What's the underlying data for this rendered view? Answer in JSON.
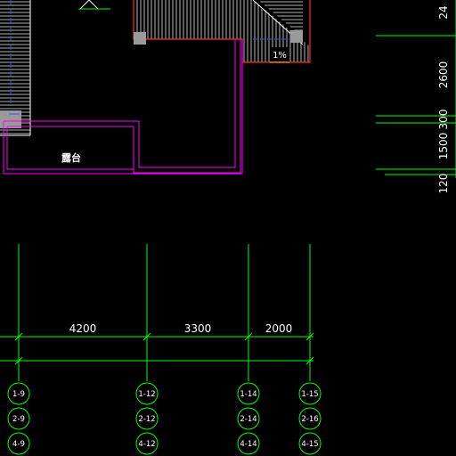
{
  "drawing": {
    "room_label": "露台",
    "slope_label": "1%",
    "horizontal_dimensions": [
      "4200",
      "3300",
      "2000"
    ],
    "vertical_dimensions": [
      "24",
      "2600",
      "300",
      "1500",
      "120"
    ],
    "axis_columns": [
      {
        "bubbles": [
          "1-9",
          "2-9",
          "4-9"
        ]
      },
      {
        "bubbles": [
          "1-12",
          "2-12",
          "4-12"
        ]
      },
      {
        "bubbles": [
          "1-14",
          "2-14",
          "4-14"
        ]
      },
      {
        "bubbles": [
          "1-15",
          "2-16",
          "4-15"
        ]
      }
    ]
  },
  "colors": {
    "background": "#000000",
    "grid_line": "#00ff00",
    "wall_outline": "#ff2a2a",
    "parapet": "#ff00ff",
    "hatch": "#ffffff",
    "blue_dash": "#3355ff",
    "drain": "#9a9a9a",
    "text": "#ffffff"
  }
}
